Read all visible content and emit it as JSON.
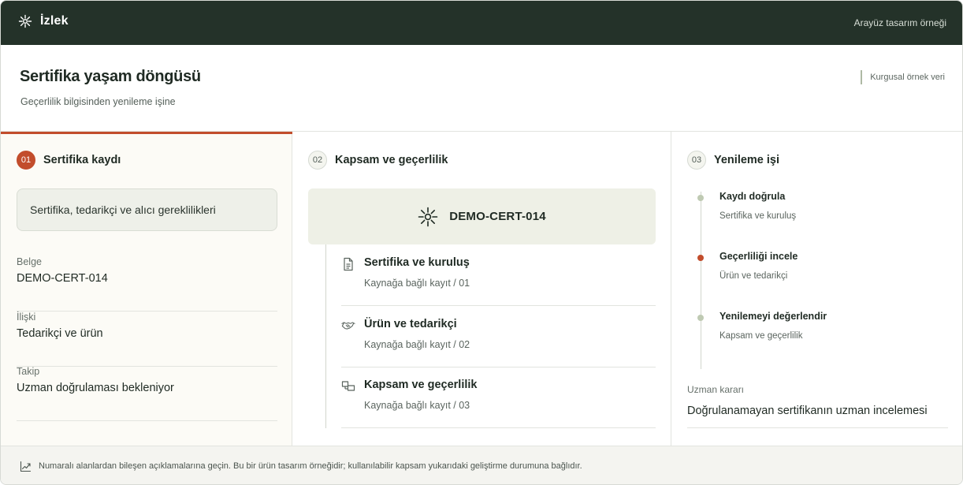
{
  "app": {
    "name": "İzlek",
    "note": "Arayüz tasarım örneği",
    "brand_icon": "asterisk-sun-icon"
  },
  "header": {
    "title": "Sertifika yaşam döngüsü",
    "subtitle": "Geçerlilik bilgisinden yenileme işine",
    "badge": "Kurgusal örnek veri"
  },
  "step1": {
    "number": "01",
    "title": "Sertifika kaydı",
    "requirements": "Sertifika, tedarikçi ve alıcı gereklilikleri",
    "fields": [
      {
        "label": "Belge",
        "value": "DEMO-CERT-014"
      },
      {
        "label": "İlişki",
        "value": "Tedarikçi ve ürün"
      },
      {
        "label": "Takip",
        "value": "Uzman doğrulaması bekleniyor"
      }
    ]
  },
  "step2": {
    "number": "02",
    "title": "Kapsam ve geçerlilik",
    "certificate": "DEMO-CERT-014",
    "certificate_icon": "asterisk-sun-icon",
    "items": [
      {
        "title": "Sertifika ve kuruluş",
        "subtitle": "Kaynağa bağlı kayıt / 01",
        "icon": "document-icon"
      },
      {
        "title": "Ürün ve tedarikçi",
        "subtitle": "Kaynağa bağlı kayıt / 02",
        "icon": "handshake-icon"
      },
      {
        "title": "Kapsam ve geçerlilik",
        "subtitle": "Kaynağa bağlı kayıt / 03",
        "icon": "boxes-icon"
      }
    ]
  },
  "step3": {
    "number": "03",
    "title": "Yenileme işi",
    "timeline": [
      {
        "title": "Kaydı doğrula",
        "subtitle": "Sertifika ve kuruluş",
        "active": false
      },
      {
        "title": "Geçerliliği incele",
        "subtitle": "Ürün ve tedarikçi",
        "active": true
      },
      {
        "title": "Yenilemeyi değerlendir",
        "subtitle": "Kapsam ve geçerlilik",
        "active": false
      }
    ],
    "decision_label": "Uzman kararı",
    "decision_value": "Doğrulanamayan sertifikanın uzman incelemesi"
  },
  "footer": {
    "icon": "trend-chart-icon",
    "text": "Numaralı alanlardan bileşen açıklamalarına geçin. Bu bir ürün tasarım örneğidir; kullanılabilir kapsam yukarıdaki geliştirme durumuna bağlıdır."
  },
  "colors": {
    "topbar": "#243229",
    "accent": "#c24d2c",
    "soft_green": "#eef0e6",
    "dot_inactive": "#bfcab3"
  }
}
